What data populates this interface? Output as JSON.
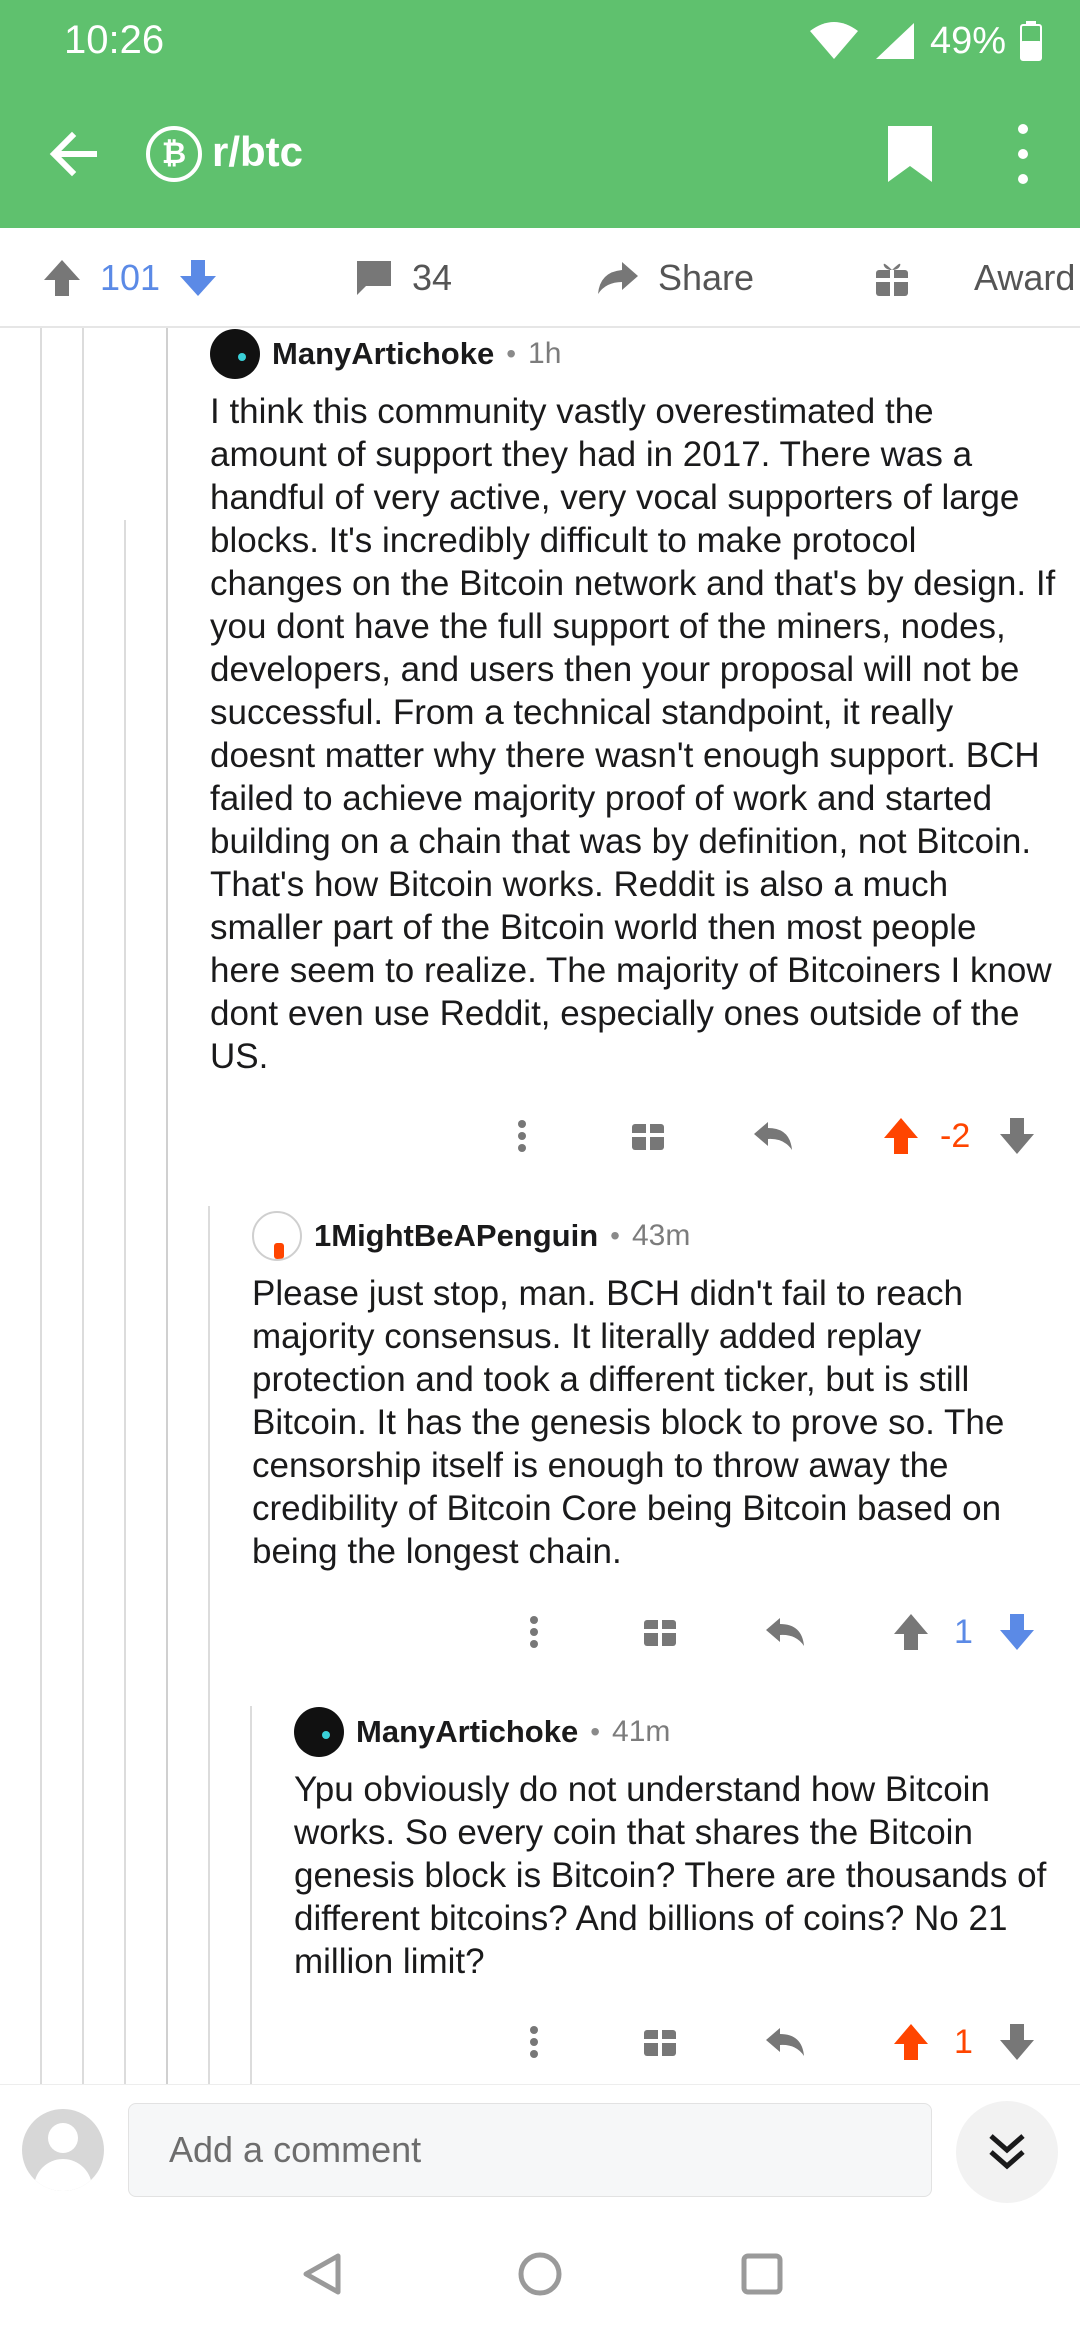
{
  "status_bar": {
    "time": "10:26",
    "battery": "49%"
  },
  "header": {
    "subreddit": "r/btc",
    "badge_glyph": "₿"
  },
  "post_actions": {
    "score": "101",
    "comments": "34",
    "share": "Share",
    "award": "Award"
  },
  "comments": [
    {
      "author": "ManyArtichoke",
      "time": "1h",
      "text": "I think this community vastly overestimated the amount of support they had in 2017. There was a handful of very active, very vocal supporters of large blocks. It's incredibly difficult to make protocol changes on the Bitcoin network and that's by design. If you dont have the full support of the miners, nodes, developers, and users then your proposal will not be successful. From a technical standpoint, it really doesnt matter why there wasn't enough support. BCH failed to achieve majority proof of work and started building on a chain that was by definition, not Bitcoin. That's how Bitcoin works. Reddit is also a much smaller part of the Bitcoin world then most people here seem to realize. The majority of Bitcoiners I know dont even use Reddit, especially ones outside of the US.",
      "score": "-2",
      "vote": "up"
    },
    {
      "author": "1MightBeAPenguin",
      "time": "43m",
      "text": "Please just stop, man. BCH didn't fail to reach majority consensus. It literally added replay protection and took a different ticker, but is still Bitcoin. It has the genesis block to prove so. The censorship itself is enough to throw away the credibility of Bitcoin Core being Bitcoin based on being the longest chain.",
      "score": "1",
      "vote": "down"
    },
    {
      "author": "ManyArtichoke",
      "time": "41m",
      "text": "Ypu obviously do not understand how Bitcoin works. So every coin that shares the Bitcoin genesis block is Bitcoin? There are thousands of different bitcoins? And billions of coins? No 21 million limit?",
      "score": "1",
      "vote": "up"
    }
  ],
  "comment_bar": {
    "placeholder": "Add a comment"
  },
  "colors": {
    "header_green": "#5fc16e",
    "upvote_orange": "#ff4500",
    "downvote_blue": "#5b8ae6"
  }
}
